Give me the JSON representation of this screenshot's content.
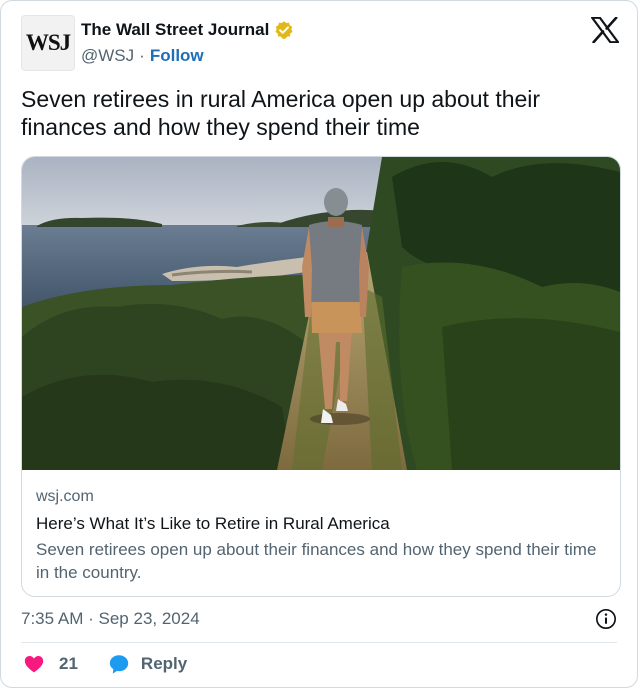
{
  "author": {
    "display_name": "The Wall Street Journal",
    "handle": "@WSJ",
    "separator": "·",
    "follow_label": "Follow",
    "avatar_text": "WSJ",
    "verified_badge": "gold-verified-badge-icon"
  },
  "platform_icon": "x-logo-icon",
  "tweet": {
    "text": "Seven retirees in rural America open up about their finances and how they spend their time"
  },
  "link_card": {
    "image": "man-walking-on-coastal-path-photo",
    "domain": "wsj.com",
    "title": "Here’s What It’s Like to Retire in Rural America",
    "description": "Seven retirees open up about their finances and how they spend their time in the country."
  },
  "meta": {
    "time": "7:35 AM",
    "separator": "·",
    "date": "Sep 23, 2024"
  },
  "actions": {
    "like_count": "21",
    "reply_label": "Reply"
  },
  "colors": {
    "text_primary": "#0f1419",
    "text_secondary": "#536471",
    "link_blue": "#1d6fb8",
    "like_pink": "#f91880",
    "reply_blue": "#1d9bf0",
    "verified_gold": "#e2b719",
    "border": "#cfd9de"
  }
}
